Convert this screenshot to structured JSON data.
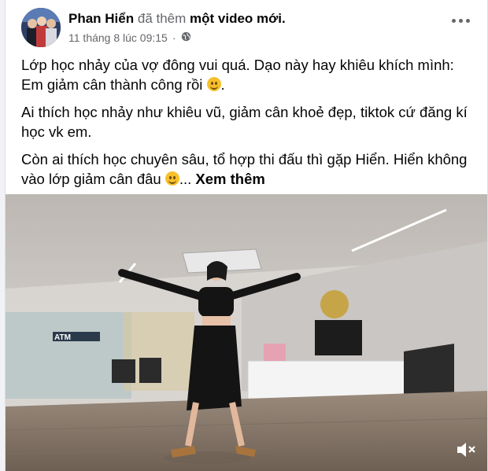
{
  "post": {
    "author": "Phan Hiển",
    "action_prefix": "đã thêm",
    "action_object": "một video mới.",
    "timestamp": "11 tháng 8 lúc 09:15",
    "privacy_icon": "globe-icon",
    "paragraphs": [
      "Lớp học nhảy của vợ đông vui quá. Dạo này hay khiêu khích mình: Em giảm cân thành công rồi",
      "Ai thích học nhảy như khiêu vũ, giảm cân khoẻ đẹp, tiktok cứ đăng kí học vk em.",
      "Còn ai thích học chuyên sâu, tổ hợp thi đấu thì gặp Hiển. Hiển không vào lớp giảm cân đâu"
    ],
    "ellipsis": "...",
    "see_more": "Xem thêm"
  },
  "video": {
    "studio_sign": "ATM",
    "mute_icon": "speaker-muted-icon"
  },
  "colors": {
    "author": "#050505",
    "meta": "#65676b",
    "background": "#f0f2f5"
  }
}
